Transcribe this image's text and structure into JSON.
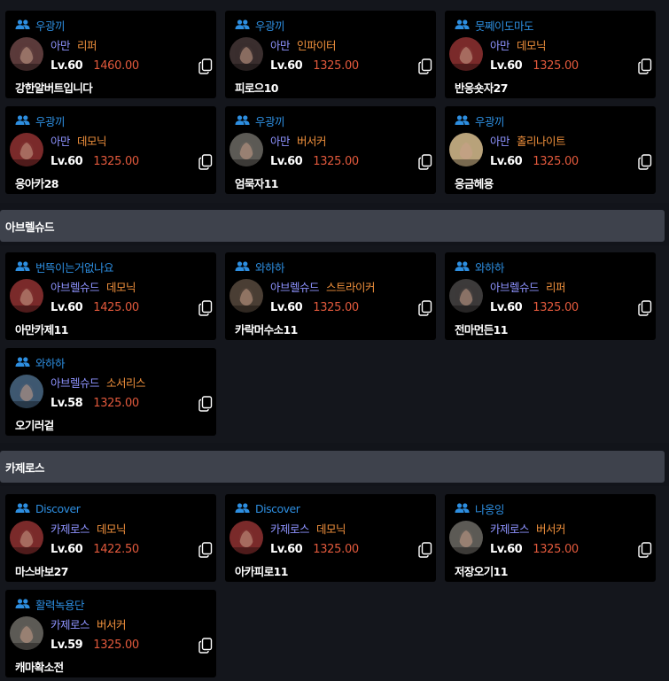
{
  "sections": [
    {
      "title": "",
      "cards": [
        {
          "guild": "우광끼",
          "server": "아만",
          "class": "리퍼",
          "level": "Lv.60",
          "item_level": "1460.00",
          "name": "강한알버트입니다",
          "avatar_color": "#5a3a3a"
        },
        {
          "guild": "우광끼",
          "server": "아만",
          "class": "인파이터",
          "level": "Lv.60",
          "item_level": "1325.00",
          "name": "피로으10",
          "avatar_color": "#3a2e2e"
        },
        {
          "guild": "뭇쩨이도마도",
          "server": "아만",
          "class": "데모닉",
          "level": "Lv.60",
          "item_level": "1325.00",
          "name": "반응숏자27",
          "avatar_color": "#7a2a2a"
        },
        {
          "guild": "우광끼",
          "server": "아만",
          "class": "데모닉",
          "level": "Lv.60",
          "item_level": "1325.00",
          "name": "응아카28",
          "avatar_color": "#7a2a2a"
        },
        {
          "guild": "우광끼",
          "server": "아만",
          "class": "버서커",
          "level": "Lv.60",
          "item_level": "1325.00",
          "name": "엄묵자11",
          "avatar_color": "#5c5a55"
        },
        {
          "guild": "우광끼",
          "server": "아만",
          "class": "홀리나이트",
          "level": "Lv.60",
          "item_level": "1325.00",
          "name": "응금헤용",
          "avatar_color": "#b8a27a"
        }
      ]
    },
    {
      "title": "아브렐슈드",
      "cards": [
        {
          "guild": "번뜩이는거없나요",
          "server": "아브렐슈드",
          "class": "데모닉",
          "level": "Lv.60",
          "item_level": "1425.00",
          "name": "아만카제11",
          "avatar_color": "#7a2a2a"
        },
        {
          "guild": "와하하",
          "server": "아브렐슈드",
          "class": "스트라이커",
          "level": "Lv.60",
          "item_level": "1325.00",
          "name": "카락머수소11",
          "avatar_color": "#4a3e34"
        },
        {
          "guild": "와하하",
          "server": "아브렐슈드",
          "class": "리퍼",
          "level": "Lv.60",
          "item_level": "1325.00",
          "name": "전마먼든11",
          "avatar_color": "#3c3a3a"
        },
        {
          "guild": "와하하",
          "server": "아브렐슈드",
          "class": "소서리스",
          "level": "Lv.58",
          "item_level": "1325.00",
          "name": "오기러겉",
          "avatar_color": "#3e5870"
        }
      ]
    },
    {
      "title": "카제로스",
      "cards": [
        {
          "guild": "Discover",
          "server": "카제로스",
          "class": "데모닉",
          "level": "Lv.60",
          "item_level": "1422.50",
          "name": "마스바보27",
          "avatar_color": "#7a2a2a"
        },
        {
          "guild": "Discover",
          "server": "카제로스",
          "class": "데모닉",
          "level": "Lv.60",
          "item_level": "1325.00",
          "name": "아카피로11",
          "avatar_color": "#7a2a2a"
        },
        {
          "guild": "나옹잉",
          "server": "카제로스",
          "class": "버서커",
          "level": "Lv.60",
          "item_level": "1325.00",
          "name": "저장오기11",
          "avatar_color": "#5c5a55"
        },
        {
          "guild": "활력녹용단",
          "server": "카제로스",
          "class": "버서커",
          "level": "Lv.59",
          "item_level": "1325.00",
          "name": "캐마확소전",
          "avatar_color": "#5c5a55"
        }
      ]
    }
  ],
  "icons": {
    "guild": "users-icon",
    "copy": "copy-icon"
  },
  "colors": {
    "guild": "#2d8ee0",
    "server": "#8e93ff",
    "class": "#f0903c",
    "item_level": "#e2593c"
  }
}
